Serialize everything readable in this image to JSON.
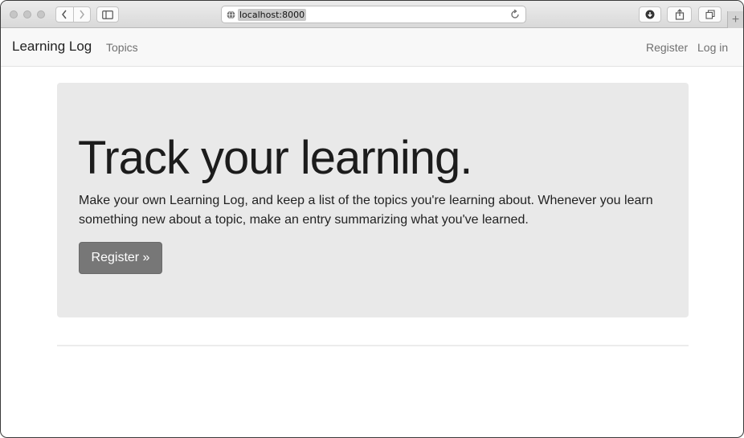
{
  "browser": {
    "address_url": "localhost:8000",
    "new_tab_label": "+"
  },
  "navbar": {
    "brand": "Learning Log",
    "links": {
      "topics": "Topics",
      "register": "Register",
      "login": "Log in"
    }
  },
  "jumbotron": {
    "title": "Track your learning.",
    "lead": "Make your own Learning Log, and keep a list of the topics you're learning about. Whenever you learn something new about a topic, make an entry summarizing what you've learned.",
    "register_button": "Register »"
  },
  "colors": {
    "jumbotron_bg": "#e9e9e9",
    "button_bg": "#777777",
    "navbar_bg": "#f8f8f8"
  }
}
